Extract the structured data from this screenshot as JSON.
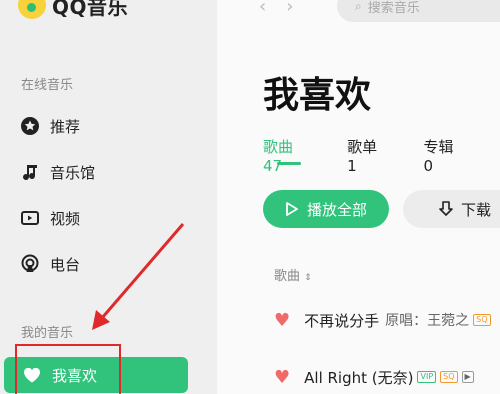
{
  "app": {
    "name": "QQ音乐"
  },
  "sidebar": {
    "online_section": "在线音乐",
    "online_items": [
      {
        "label": "推荐",
        "icon": "star-circle-icon"
      },
      {
        "label": "音乐馆",
        "icon": "music-note-icon"
      },
      {
        "label": "视频",
        "icon": "video-icon"
      },
      {
        "label": "电台",
        "icon": "radio-icon"
      }
    ],
    "my_section": "我的音乐",
    "my_items": [
      {
        "label": "我喜欢",
        "icon": "heart-icon",
        "active": true
      }
    ]
  },
  "topbar": {
    "search_placeholder": "搜索音乐"
  },
  "main": {
    "title": "我喜欢",
    "tabs": [
      {
        "label": "歌曲47",
        "active": true
      },
      {
        "label": "歌单1",
        "active": false
      },
      {
        "label": "专辑0",
        "active": false
      }
    ],
    "play_all_label": "播放全部",
    "download_label": "下载",
    "column_header": "歌曲",
    "songs": [
      {
        "title": "不再说分手",
        "artist": "原唱：王菀之",
        "tags": [
          "SQ"
        ]
      },
      {
        "title": "All Right (无奈)",
        "artist": "",
        "tags": [
          "VIP",
          "SQ",
          "▶"
        ]
      }
    ]
  },
  "colors": {
    "accent": "#31c27c",
    "annotation": "#e0292b"
  }
}
